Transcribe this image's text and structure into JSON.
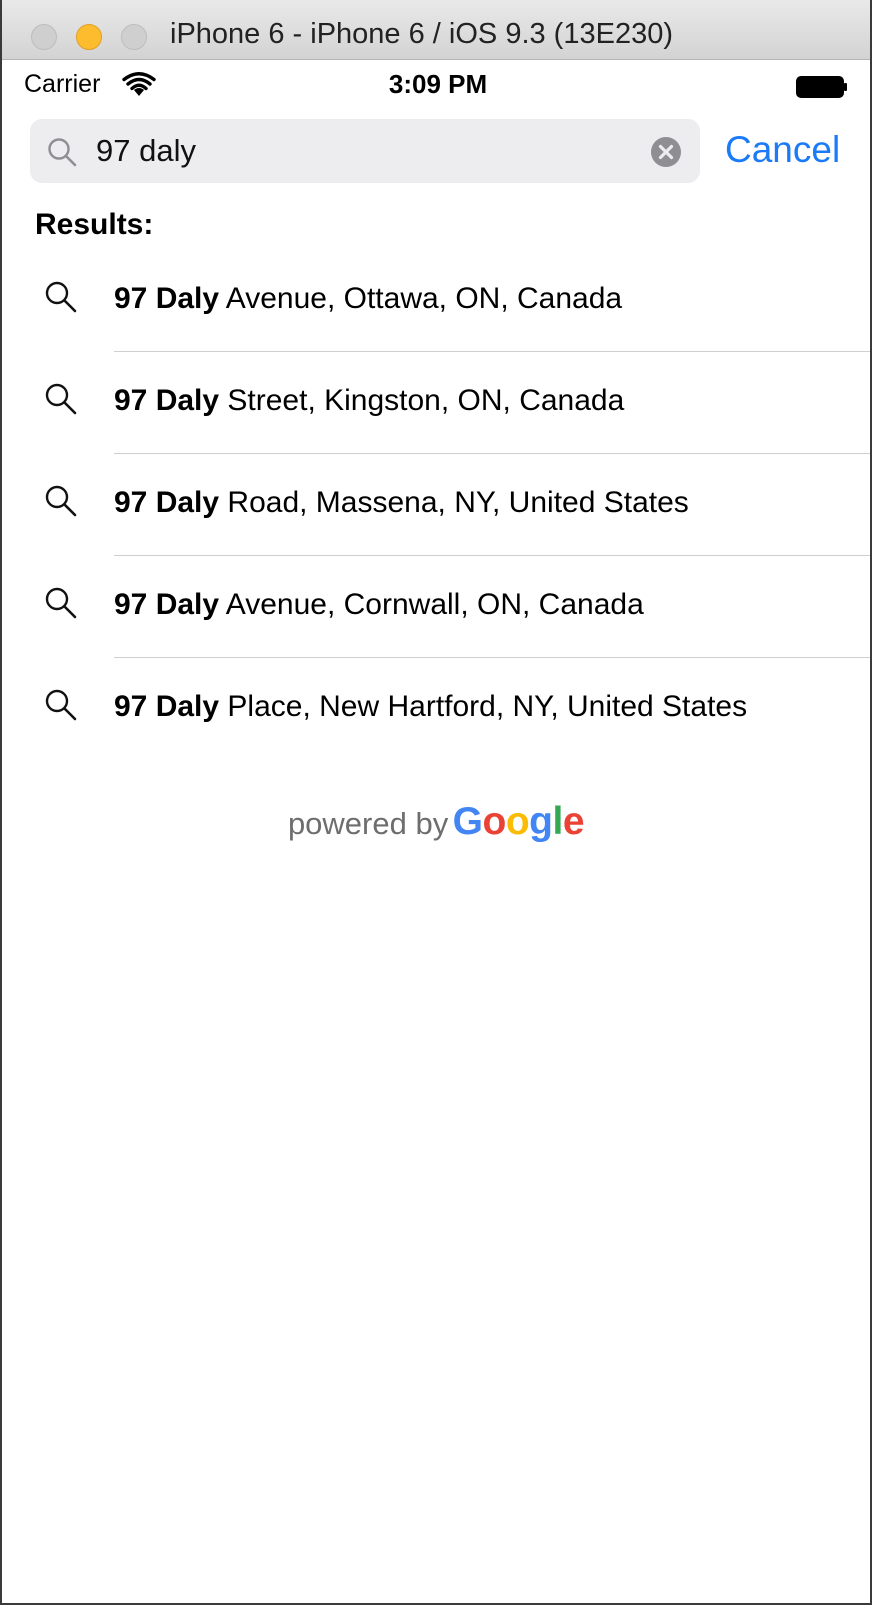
{
  "window": {
    "title": "iPhone 6 - iPhone 6 / iOS 9.3 (13E230)"
  },
  "status_bar": {
    "carrier": "Carrier",
    "time": "3:09 PM"
  },
  "search": {
    "query": "97 daly",
    "cancel_label": "Cancel"
  },
  "results": {
    "header": "Results:",
    "items": [
      {
        "match": "97 Daly",
        "rest": " Avenue, Ottawa, ON, Canada"
      },
      {
        "match": "97 Daly",
        "rest": " Street, Kingston, ON, Canada"
      },
      {
        "match": "97 Daly",
        "rest": " Road, Massena, NY, United States"
      },
      {
        "match": "97 Daly",
        "rest": " Avenue, Cornwall, ON, Canada"
      },
      {
        "match": "97 Daly",
        "rest": " Place, New Hartford, NY, United States"
      }
    ]
  },
  "footer": {
    "powered_by": "powered by",
    "brand_letters": [
      "G",
      "o",
      "o",
      "g",
      "l",
      "e"
    ],
    "brand_colors": [
      "#4285F4",
      "#EA4335",
      "#FBBC05",
      "#4285F4",
      "#34A853",
      "#EA4335"
    ]
  },
  "colors": {
    "accent": "#1a7af8",
    "traffic_minimize": "#fdbc2e"
  },
  "icons": {
    "traffic_close": "close-dot",
    "traffic_minimize": "minimize-dot",
    "traffic_maximize": "maximize-dot",
    "wifi": "wifi-icon",
    "battery": "battery-icon",
    "search": "search-icon",
    "clear": "clear-icon",
    "result": "search-icon"
  }
}
